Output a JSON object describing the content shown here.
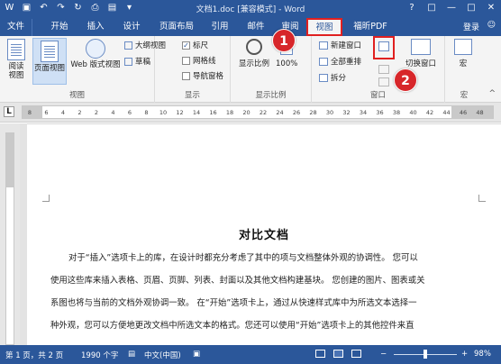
{
  "window": {
    "title": "文档1.doc [兼容模式] - Word",
    "qat_icons": [
      "word-logo-icon",
      "save-icon",
      "undo-icon",
      "redo-icon",
      "repeat-icon",
      "print-icon",
      "open-icon",
      "customize-icon"
    ],
    "controls": [
      "?",
      "□",
      "—",
      "□",
      "✕"
    ]
  },
  "tabs": [
    {
      "label": "文件"
    },
    {
      "label": "开始"
    },
    {
      "label": "插入"
    },
    {
      "label": "设计"
    },
    {
      "label": "页面布局"
    },
    {
      "label": "引用"
    },
    {
      "label": "邮件"
    },
    {
      "label": "审阅"
    },
    {
      "label": "视图"
    },
    {
      "label": "福昕PDF"
    }
  ],
  "active_tab": "视图",
  "login_label": "登录",
  "ribbon": {
    "views": {
      "label": "视图",
      "read_mode": "阅读视图",
      "print_layout": "页面视图",
      "web_layout": "Web 版式视图",
      "outline": "大纲视图",
      "draft": "草稿"
    },
    "show": {
      "label": "显示",
      "ruler": "标尺",
      "gridlines": "网格线",
      "nav_pane": "导航窗格"
    },
    "zoom": {
      "label": "显示比例",
      "zoom_btn": "显示比例",
      "hundred": "100%"
    },
    "window": {
      "label": "窗口",
      "new_window": "新建窗口",
      "arrange_all": "全部重排",
      "split": "拆分",
      "switch_windows": "切换窗口"
    },
    "macros": {
      "label": "宏",
      "macro_btn": "宏"
    }
  },
  "annotations": {
    "badge1": "1",
    "badge2": "2"
  },
  "ruler_ticks": [
    "8",
    "6",
    "4",
    "2",
    "2",
    "4",
    "6",
    "8",
    "10",
    "12",
    "14",
    "16",
    "18",
    "20",
    "22",
    "24",
    "26",
    "28",
    "30",
    "32",
    "34",
    "36",
    "38",
    "40",
    "42",
    "44",
    "46",
    "48"
  ],
  "document": {
    "title": "对比文档",
    "lines": [
      "对于“插入”选项卡上的库，在设计时都充分考虑了其中的项与文档整体外观的协调性。 您可以",
      "使用这些库来插入表格、页眉、页脚、列表、封面以及其他文档构建基块。 您创建的图片、图表或关",
      "系图也将与当前的文档外观协调一致。 在“开始”选项卡上，通过从快速样式库中为所选文本选择一",
      "种外观，您可以方便地更改文档中所选文本的格式。您还可以使用“开始”选项卡上的其他控件来直"
    ]
  },
  "status": {
    "page": "第 1 页，共 2 页",
    "words": "1990 个字",
    "language": "中文(中国)",
    "zoom": "98%"
  },
  "colors": {
    "word_blue": "#2b579a",
    "annotation_red": "#e02020"
  }
}
